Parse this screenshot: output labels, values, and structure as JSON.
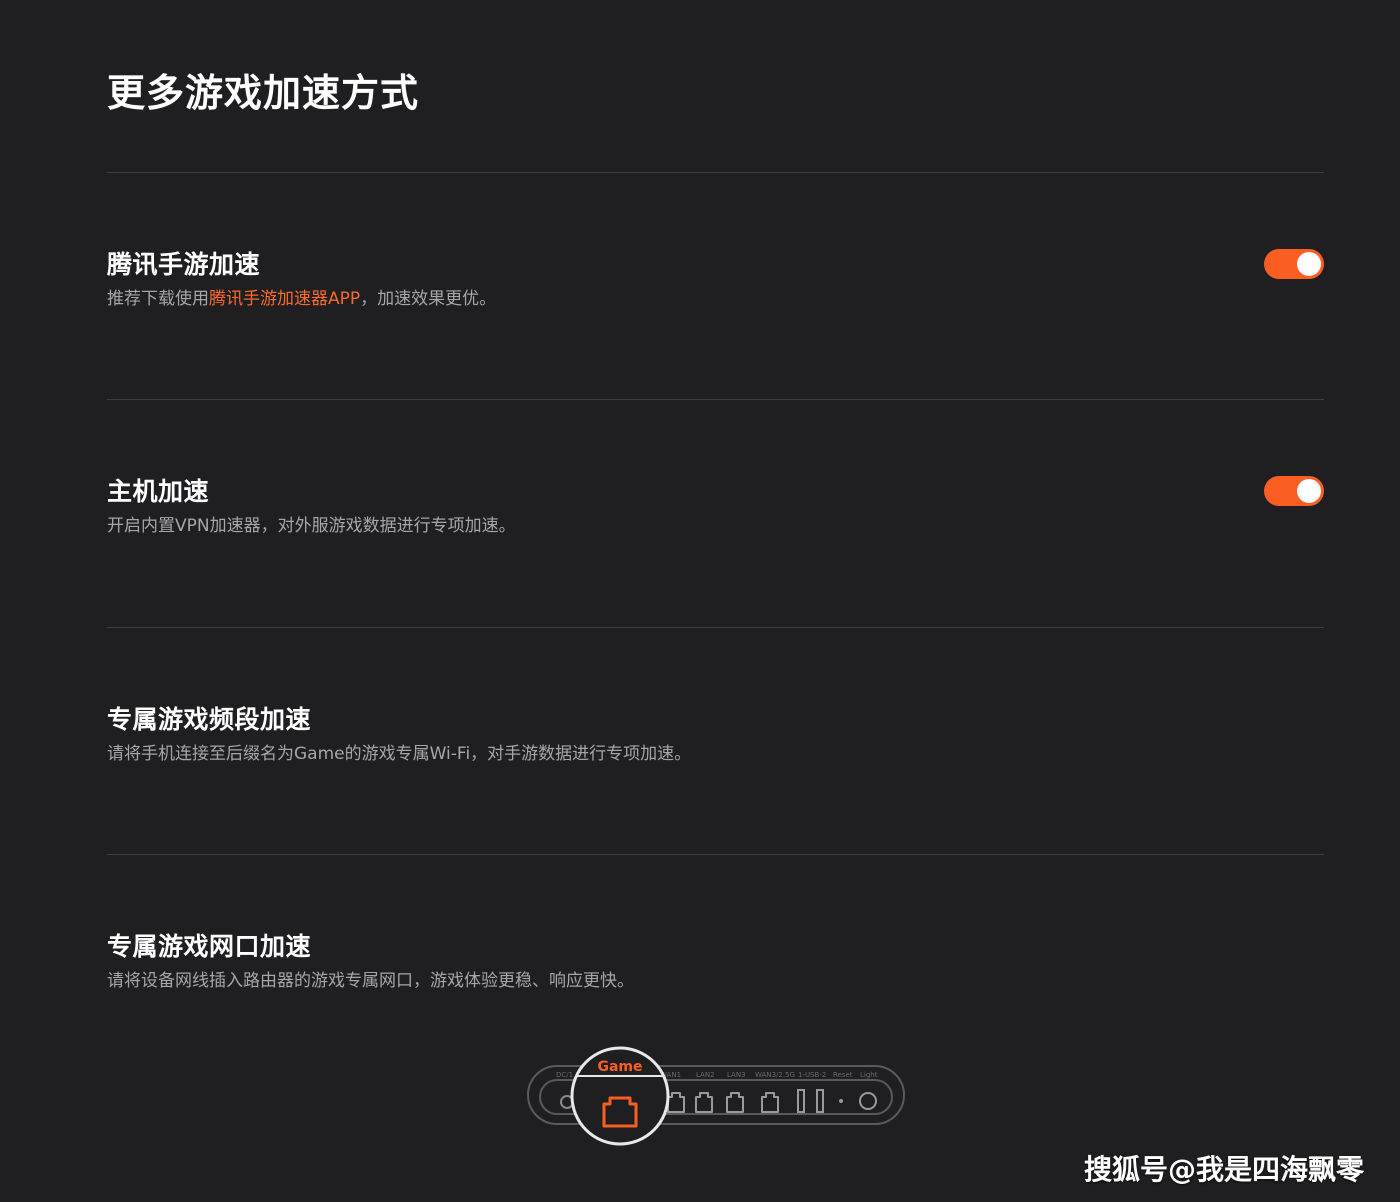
{
  "page": {
    "title": "更多游戏加速方式"
  },
  "sections": [
    {
      "title": "腾讯手游加速",
      "description_prefix": "推荐下载使用",
      "description_link": "腾讯手游加速器APP",
      "description_suffix": "，加速效果更优。",
      "toggle_on": true
    },
    {
      "title": "主机加速",
      "description": "开启内置VPN加速器，对外服游戏数据进行专项加速。",
      "toggle_on": true
    },
    {
      "title": "专属游戏频段加速",
      "description": "请将手机连接至后缀名为Game的游戏专属Wi-Fi，对手游数据进行专项加速。"
    },
    {
      "title": "专属游戏网口加速",
      "description": "请将设备网线插入路由器的游戏专属网口，游戏体验更稳、响应更快。"
    }
  ],
  "router": {
    "highlight_label": "Game",
    "port_labels": [
      "DC/1",
      "WAN1",
      "LAN2",
      "LAN3",
      "WAN3/2.5G",
      "1-USB-2",
      "Reset",
      "Light"
    ],
    "highlight_icon": "ethernet-port-icon"
  },
  "watermark": "搜狐号@我是四海飘零",
  "colors": {
    "background": "#1f1f21",
    "accent": "#fb5e22",
    "text_primary": "#ffffff",
    "text_secondary": "#a6a6a8",
    "divider": "#3d3d40"
  }
}
